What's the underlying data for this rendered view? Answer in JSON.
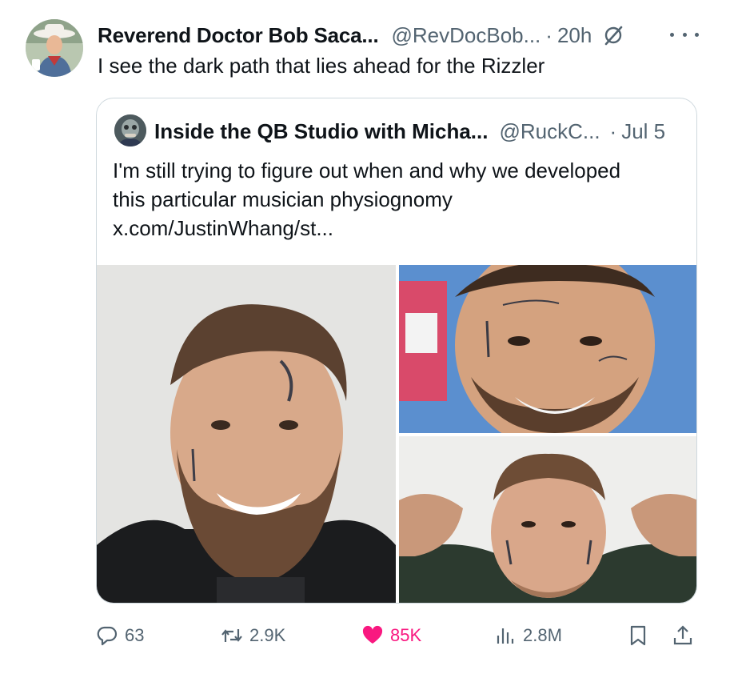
{
  "post": {
    "author_name": "Reverend Doctor Bob Saca...",
    "author_handle": "@RevDocBob...",
    "separator": "·",
    "time": "20h",
    "text": "I see the dark path that lies ahead for the Rizzler",
    "icons": {
      "avatar": "avatar-cowboy",
      "grok": "grok-icon",
      "more": "more-icon"
    }
  },
  "quoted": {
    "author_name": "Inside the QB Studio with Micha...",
    "author_handle": "@RuckC...",
    "separator": "·",
    "time": "Jul 5",
    "text_lines": [
      "I'm still trying to figure out when and why we developed",
      "this particular musician physiognomy",
      "x.com/JustinWhang/st..."
    ],
    "photos": [
      "photo-bearded-man",
      "photo-face-tattoos",
      "photo-buzzcut-man"
    ]
  },
  "actions": {
    "replies": "63",
    "reposts": "2.9K",
    "likes": "85K",
    "views": "2.8M",
    "like_color": "#f91880",
    "icons": [
      "reply-icon",
      "repost-icon",
      "heart-icon",
      "views-icon",
      "bookmark-icon",
      "share-icon"
    ]
  }
}
